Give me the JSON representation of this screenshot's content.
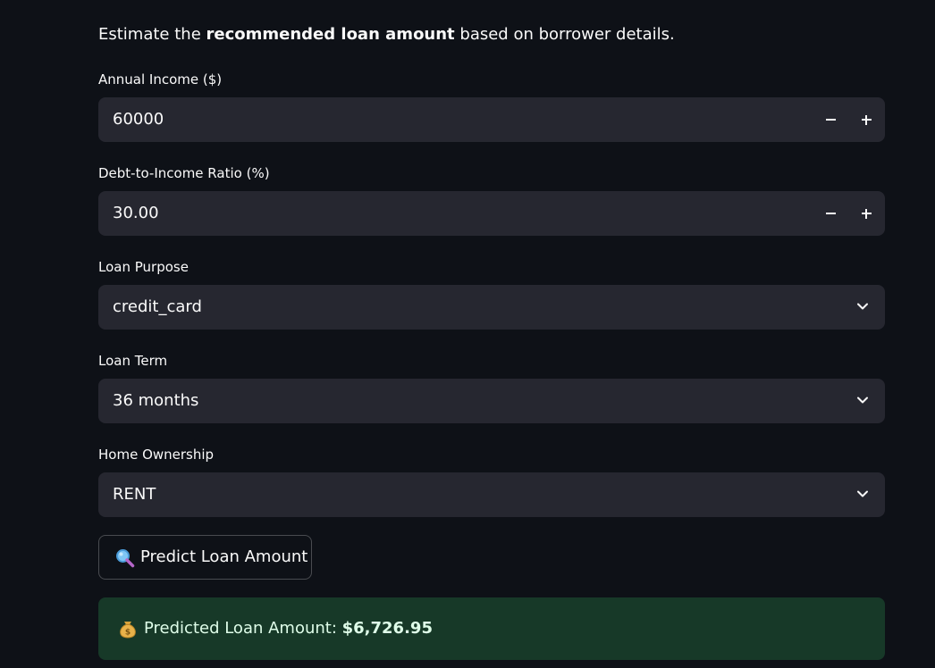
{
  "intro": {
    "prefix": "Estimate the ",
    "emphasis": "recommended loan amount",
    "suffix": " based on borrower details."
  },
  "form": {
    "annual_income": {
      "label": "Annual Income ($)",
      "value": "60000"
    },
    "dti": {
      "label": "Debt-to-Income Ratio (%)",
      "value": "30.00"
    },
    "loan_purpose": {
      "label": "Loan Purpose",
      "selected": "credit_card"
    },
    "loan_term": {
      "label": "Loan Term",
      "selected": "36 months"
    },
    "home_ownership": {
      "label": "Home Ownership",
      "selected": "RENT"
    }
  },
  "predict_button": {
    "icon": "magnifying-glass-icon",
    "label": "Predict Loan Amount"
  },
  "result": {
    "icon": "money-bag-icon",
    "label": "Predicted Loan Amount: ",
    "amount": "$6,726.95"
  },
  "colors": {
    "background": "#0e1117",
    "field": "#262730",
    "success_bg": "#173928",
    "success_text": "#dffde9"
  }
}
